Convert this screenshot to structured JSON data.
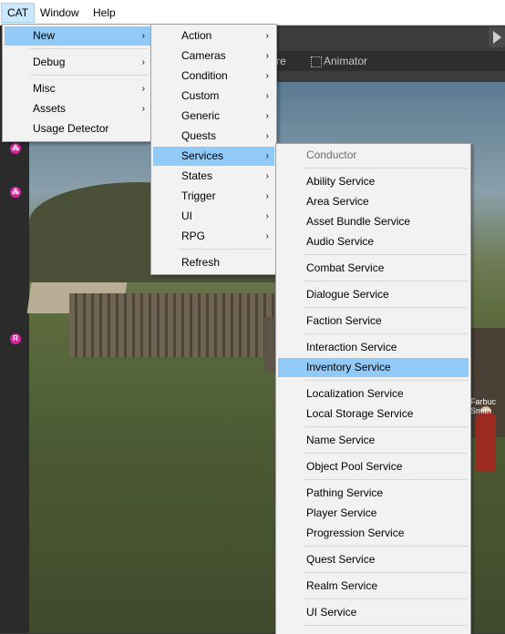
{
  "menubar": [
    "CAT",
    "Window",
    "Help"
  ],
  "editor": {
    "tab_partial": "re",
    "animator": "Animator",
    "sign_text": "Farbuc Smith"
  },
  "cat_menu": [
    {
      "label": "New",
      "arrow": "›"
    },
    {
      "label": "Debug",
      "arrow": "›"
    },
    {
      "label": "Misc",
      "arrow": "›"
    },
    {
      "label": "Assets",
      "arrow": "›"
    },
    {
      "label": "Usage Detector",
      "arrow": ""
    }
  ],
  "new_menu": [
    {
      "label": "Action",
      "arrow": "›"
    },
    {
      "label": "Cameras",
      "arrow": "›"
    },
    {
      "label": "Condition",
      "arrow": "›"
    },
    {
      "label": "Custom",
      "arrow": "›"
    },
    {
      "label": "Generic",
      "arrow": "›"
    },
    {
      "label": "Quests",
      "arrow": "›"
    },
    {
      "label": "Services",
      "arrow": "›"
    },
    {
      "label": "States",
      "arrow": "›"
    },
    {
      "label": "Trigger",
      "arrow": "›"
    },
    {
      "label": "UI",
      "arrow": "›"
    },
    {
      "label": "RPG",
      "arrow": "›"
    },
    {
      "label": "Refresh",
      "arrow": ""
    }
  ],
  "services_menu": [
    "Conductor",
    "Ability Service",
    "Area Service",
    "Asset Bundle Service",
    "Audio Service",
    "Combat Service",
    "Dialogue Service",
    "Faction Service",
    "Interaction Service",
    "Inventory Service",
    "Localization Service",
    "Local Storage Service",
    "Name Service",
    "Object Pool Service",
    "Pathing Service",
    "Player Service",
    "Progression Service",
    "Quest Service",
    "Realm Service",
    "UI Service"
  ]
}
